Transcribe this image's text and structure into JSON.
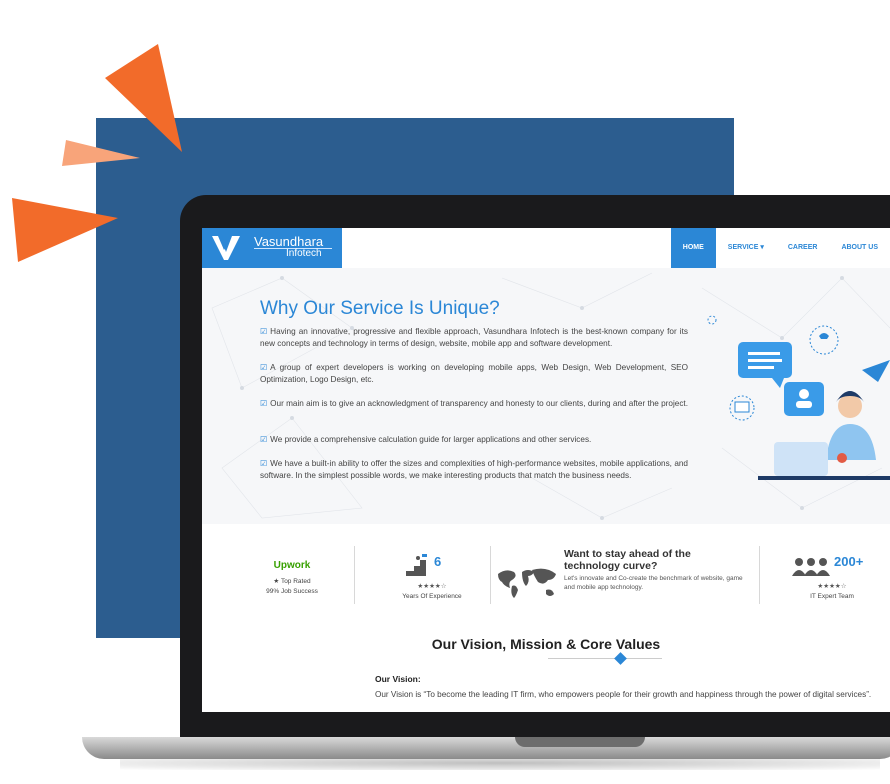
{
  "nav": {
    "logo_name": "Vasundhara",
    "logo_sub": "Infotech",
    "items": [
      {
        "label": "HOME",
        "active": true
      },
      {
        "label": "SERVICE ▾",
        "active": false
      },
      {
        "label": "CAREER",
        "active": false
      },
      {
        "label": "ABOUT US",
        "active": false
      }
    ]
  },
  "hero": {
    "title": "Why Our Service Is Unique?",
    "bullets": [
      "Having an innovative, progressive and flexible approach, Vasundhara Infotech is the best-known company for its new concepts and technology in terms of design, website, mobile app and software development.",
      "A group of expert developers is working on developing mobile apps, Web Design, Web Development, SEO Optimization, Logo Design, etc.",
      "Our main aim is to give an acknowledgment of transparency and honesty to our clients, during and after the project.",
      "We provide a comprehensive calculation guide for larger applications and other services.",
      "We have a built-in ability to offer the sizes and complexities of high-performance websites, mobile applications, and software. In the simplest possible words, we make interesting products that match the business needs."
    ]
  },
  "stats": {
    "upwork": {
      "logo": "Upwork",
      "line1": "★ Top Rated",
      "line2": "99% Job Success"
    },
    "experience": {
      "number": "6",
      "stars": "★★★★☆",
      "label": "Years Of Experience"
    },
    "cta": {
      "title": "Want to stay ahead of the technology curve?",
      "subtitle": "Let's innovate and Co-create the benchmark of website, game and mobile app technology."
    },
    "team": {
      "number": "200+",
      "stars": "★★★★☆",
      "label": "IT Expert Team"
    }
  },
  "vision": {
    "title": "Our Vision, Mission & Core Values",
    "label": "Our Vision:",
    "text": "Our Vision is “To become the leading IT firm, who empowers people for their growth and happiness through the power of digital services”."
  },
  "colors": {
    "accent": "#2b87d6",
    "backdrop": "#2c5d8f",
    "spark": "#f26b2a"
  }
}
